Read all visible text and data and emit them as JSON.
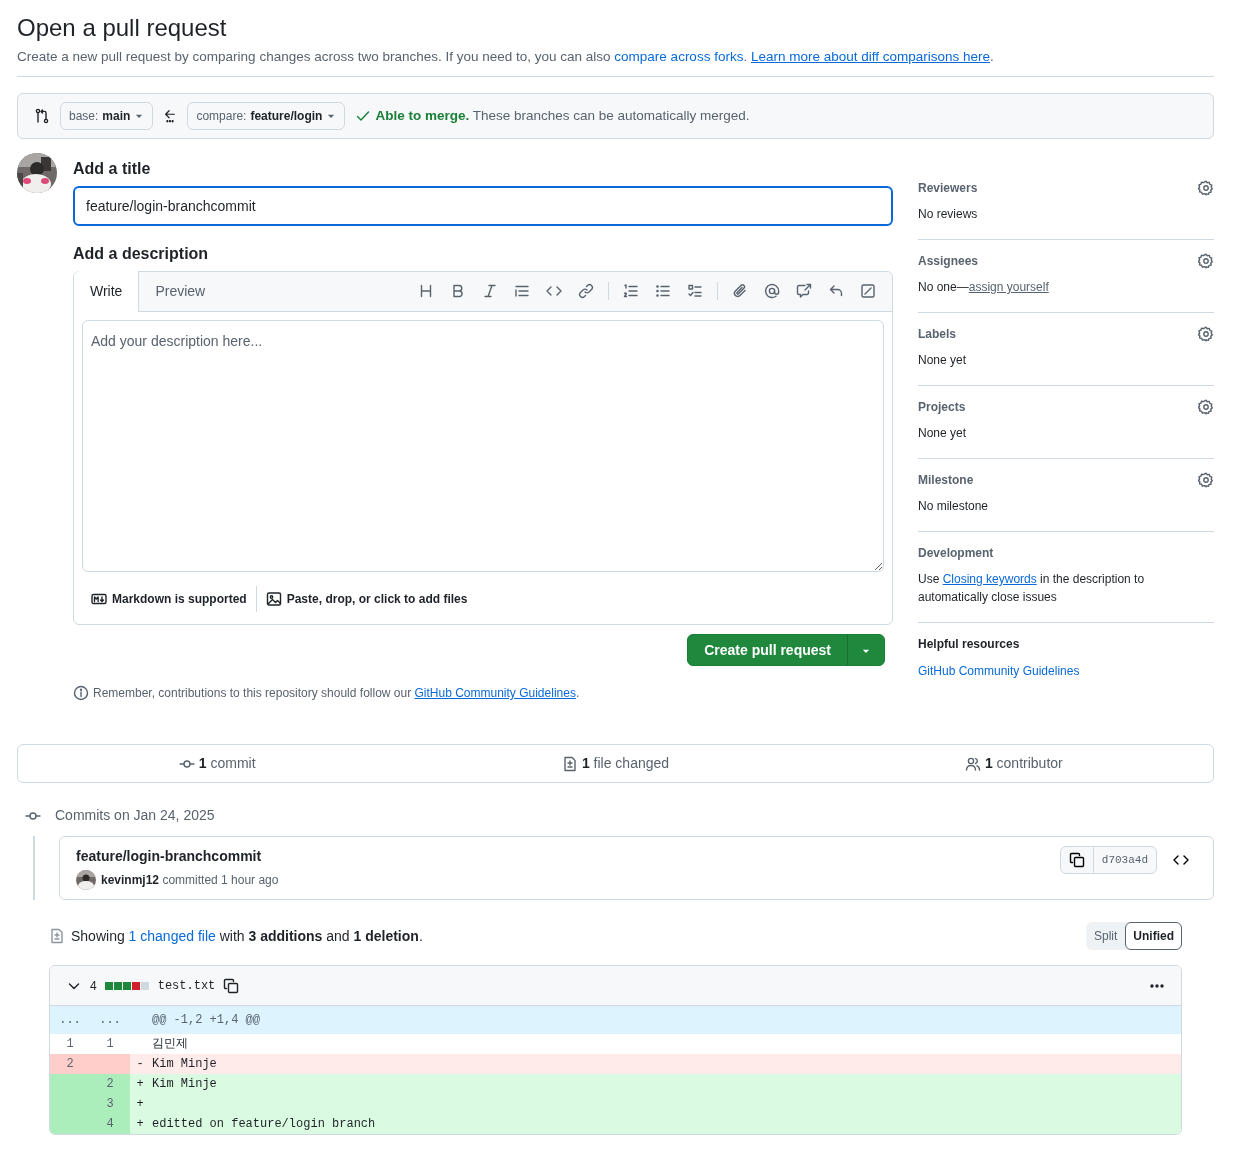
{
  "header": {
    "title": "Open a pull request",
    "description": [
      {
        "kind": "text",
        "text": "Create a new pull request by comparing changes across two branches. If you need to, you can also "
      },
      {
        "kind": "link",
        "text": "compare across forks"
      },
      {
        "kind": "text",
        "text": ". "
      },
      {
        "kind": "underlined_link",
        "text": "Learn more about diff comparisons here"
      },
      {
        "kind": "text",
        "text": "."
      }
    ]
  },
  "compare_bar": {
    "base": {
      "label": "base:",
      "value": "main"
    },
    "compare": {
      "label": "compare:",
      "value": "feature/login"
    },
    "merge_status": {
      "title": "Able to merge.",
      "text": "These branches can be automatically merged."
    }
  },
  "title_section": {
    "heading": "Add a title",
    "value": "feature/login-branchcommit"
  },
  "description_section": {
    "heading": "Add a description",
    "tabs": [
      {
        "label": "Write",
        "selected": true
      },
      {
        "label": "Preview",
        "selected": false
      }
    ],
    "placeholder": "Add your description here...",
    "footer": [
      {
        "kind": "markdown",
        "text": "Markdown is supported"
      },
      {
        "kind": "files",
        "text": "Paste, drop, or click to add files"
      }
    ]
  },
  "create_button": {
    "label": "Create pull request"
  },
  "notice": [
    {
      "kind": "text",
      "text": "Remember, contributions to this repository should follow our "
    },
    {
      "kind": "underlined_link",
      "text": "GitHub Community Guidelines"
    },
    {
      "kind": "text",
      "text": "."
    }
  ],
  "sidebar": [
    {
      "kind": "field",
      "title": "Reviewers",
      "body": [
        {
          "kind": "text",
          "text": "No reviews"
        }
      ]
    },
    {
      "kind": "field",
      "title": "Assignees",
      "body": [
        {
          "kind": "text",
          "text": "No one—"
        },
        {
          "kind": "muted_link",
          "text": "assign yourself"
        }
      ]
    },
    {
      "kind": "field",
      "title": "Labels",
      "body": [
        {
          "kind": "text",
          "text": "None yet"
        }
      ]
    },
    {
      "kind": "field",
      "title": "Projects",
      "body": [
        {
          "kind": "text",
          "text": "None yet"
        }
      ]
    },
    {
      "kind": "field",
      "title": "Milestone",
      "body": [
        {
          "kind": "text",
          "text": "No milestone"
        }
      ]
    },
    {
      "kind": "info",
      "title": "Development",
      "body": [
        {
          "kind": "text",
          "text": "Use "
        },
        {
          "kind": "underlined_link",
          "text": "Closing keywords"
        },
        {
          "kind": "text",
          "text": " in the description to automatically close issues"
        }
      ]
    },
    {
      "kind": "resources",
      "title": "Helpful resources",
      "body": [
        {
          "kind": "link",
          "text": "GitHub Community Guidelines"
        }
      ]
    }
  ],
  "summary": [
    {
      "kind": "commit",
      "count": "1",
      "label": "commit"
    },
    {
      "kind": "file",
      "count": "1",
      "label": "file changed"
    },
    {
      "kind": "people",
      "count": "1",
      "label": "contributor"
    }
  ],
  "commits": {
    "date": "Commits on Jan 24, 2025",
    "items": [
      {
        "message": "feature/login-branchcommit",
        "author": "kevinmj12",
        "meta": "committed 1 hour ago",
        "sha": "d703a4d"
      }
    ]
  },
  "diff_summary": [
    {
      "kind": "text",
      "text": "Showing "
    },
    {
      "kind": "link",
      "text": "1 changed file"
    },
    {
      "kind": "text",
      "text": " with **3 additions** and **1 deletion**."
    }
  ],
  "view_modes": [
    {
      "label": "Split",
      "selected": false
    },
    {
      "label": "Unified",
      "selected": true
    }
  ],
  "file": {
    "changes": "4",
    "stat": [
      {
        "color": "#1f883d"
      },
      {
        "color": "#1f883d"
      },
      {
        "color": "#1f883d"
      },
      {
        "color": "#cf222e"
      },
      {
        "color": "#d1d9e0"
      }
    ],
    "name": "test.txt",
    "lines": [
      {
        "kind": "hunk",
        "old": "...",
        "new": "...",
        "text": "@@ -1,2 +1,4 @@"
      },
      {
        "kind": "context",
        "old": "1",
        "new": "1",
        "text": "김민제"
      },
      {
        "kind": "deletion",
        "old": "2",
        "marker": "-",
        "text": "Kim Minje"
      },
      {
        "kind": "addition",
        "new": "2",
        "marker": "+",
        "text": "Kim Minje"
      },
      {
        "kind": "addition",
        "new": "3",
        "marker": "+"
      },
      {
        "kind": "addition",
        "new": "4",
        "marker": "+",
        "text": "editted on feature/login branch"
      }
    ]
  }
}
